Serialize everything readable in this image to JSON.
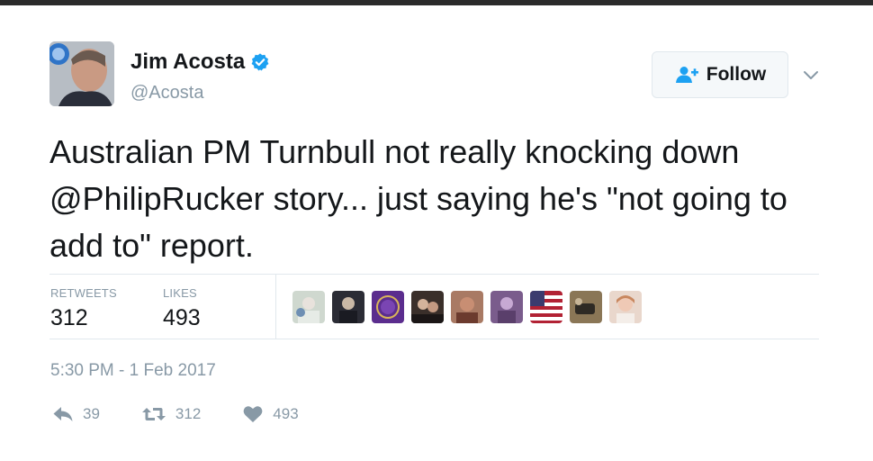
{
  "author": {
    "name": "Jim Acosta",
    "handle": "@Acosta",
    "verified": true
  },
  "follow_button": {
    "label": "Follow"
  },
  "tweet": {
    "text": "Australian PM Turnbull not really knocking down @PhilipRucker story... just saying he's \"not going to add to\" report.",
    "timestamp": "5:30 PM - 1 Feb 2017"
  },
  "stats": {
    "retweets_label": "RETWEETS",
    "retweets": "312",
    "likes_label": "LIKES",
    "likes": "493"
  },
  "actions": {
    "reply_count": "39",
    "retweet_count": "312",
    "like_count": "493"
  },
  "colors": {
    "accent": "#1da1f2",
    "text": "#14171a",
    "muted": "#8899a6",
    "border": "#e1e8ed"
  },
  "icons": {
    "verified": "verified-badge-icon",
    "follow": "person-plus-icon",
    "caret": "chevron-down-icon",
    "reply": "reply-icon",
    "retweet": "retweet-icon",
    "like": "heart-icon"
  }
}
